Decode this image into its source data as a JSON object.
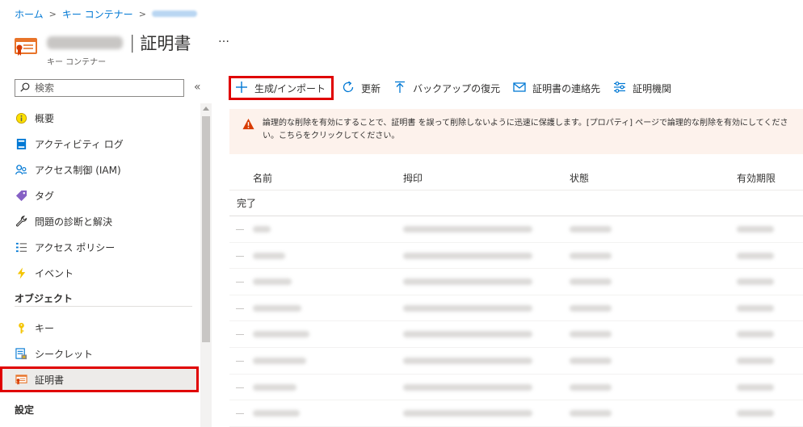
{
  "breadcrumb": {
    "home": "ホーム",
    "sep": ">",
    "vault_list": "キー コンテナー"
  },
  "header": {
    "separator": "|",
    "title": "証明書",
    "more": "…",
    "subtitle": "キー コンテナー"
  },
  "sidebar": {
    "search_placeholder": "検索",
    "collapse": "«",
    "items": [
      {
        "label": "概要",
        "icon": "overview-icon"
      },
      {
        "label": "アクティビティ ログ",
        "icon": "activity-log-icon"
      },
      {
        "label": "アクセス制御 (IAM)",
        "icon": "access-control-icon"
      },
      {
        "label": "タグ",
        "icon": "tag-icon"
      },
      {
        "label": "問題の診断と解決",
        "icon": "wrench-icon"
      },
      {
        "label": "アクセス ポリシー",
        "icon": "access-policy-icon"
      },
      {
        "label": "イベント",
        "icon": "lightning-icon"
      }
    ],
    "section_objects": "オブジェクト",
    "objects": [
      {
        "label": "キー",
        "icon": "key-icon"
      },
      {
        "label": "シークレット",
        "icon": "secret-icon"
      },
      {
        "label": "証明書",
        "icon": "certificate-icon",
        "selected": true
      }
    ],
    "section_settings": "設定"
  },
  "toolbar": {
    "generate_import": "生成/インポート",
    "refresh": "更新",
    "restore_backup": "バックアップの復元",
    "certificate_contacts": "証明書の連絡先",
    "certificate_authorities": "証明機関"
  },
  "notice": {
    "text": "論理的な削除を有効にすることで、証明書 を誤って削除しないように迅速に保護します。[プロパティ] ページで論理的な削除を有効にしてください。こちらをクリックしてください。"
  },
  "table": {
    "columns": [
      "名前",
      "拇印",
      "状態",
      "有効期限"
    ],
    "group_label": "完了"
  },
  "colors": {
    "accent": "#0078d4",
    "highlight": "#e00000",
    "warning": "#d83b01",
    "notice_bg": "#fdf2ec"
  }
}
